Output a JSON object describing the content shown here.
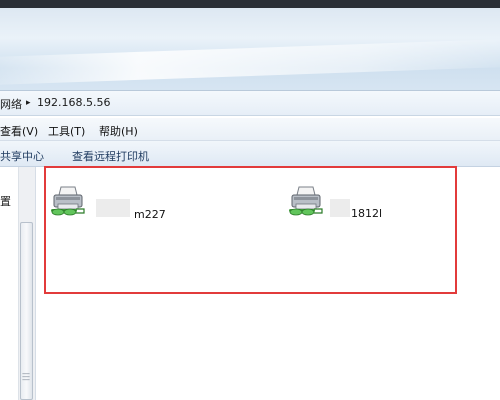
{
  "address": {
    "breadcrumb": "网络",
    "separator": "▸",
    "location": "192.168.5.56"
  },
  "menu": {
    "items": [
      "查看(V)",
      "工具(T)",
      "帮助(H)"
    ]
  },
  "toolbar": {
    "items": [
      "共享中心",
      "查看远程打印机"
    ]
  },
  "navpane": {
    "partial_label": "置"
  },
  "printers": [
    {
      "label": "m227",
      "icon": "network-printer-icon"
    },
    {
      "label": "1812l",
      "icon": "network-printer-icon"
    }
  ],
  "colors": {
    "highlight": "#e23b3b",
    "toolbar_text": "#1e3a5f"
  }
}
